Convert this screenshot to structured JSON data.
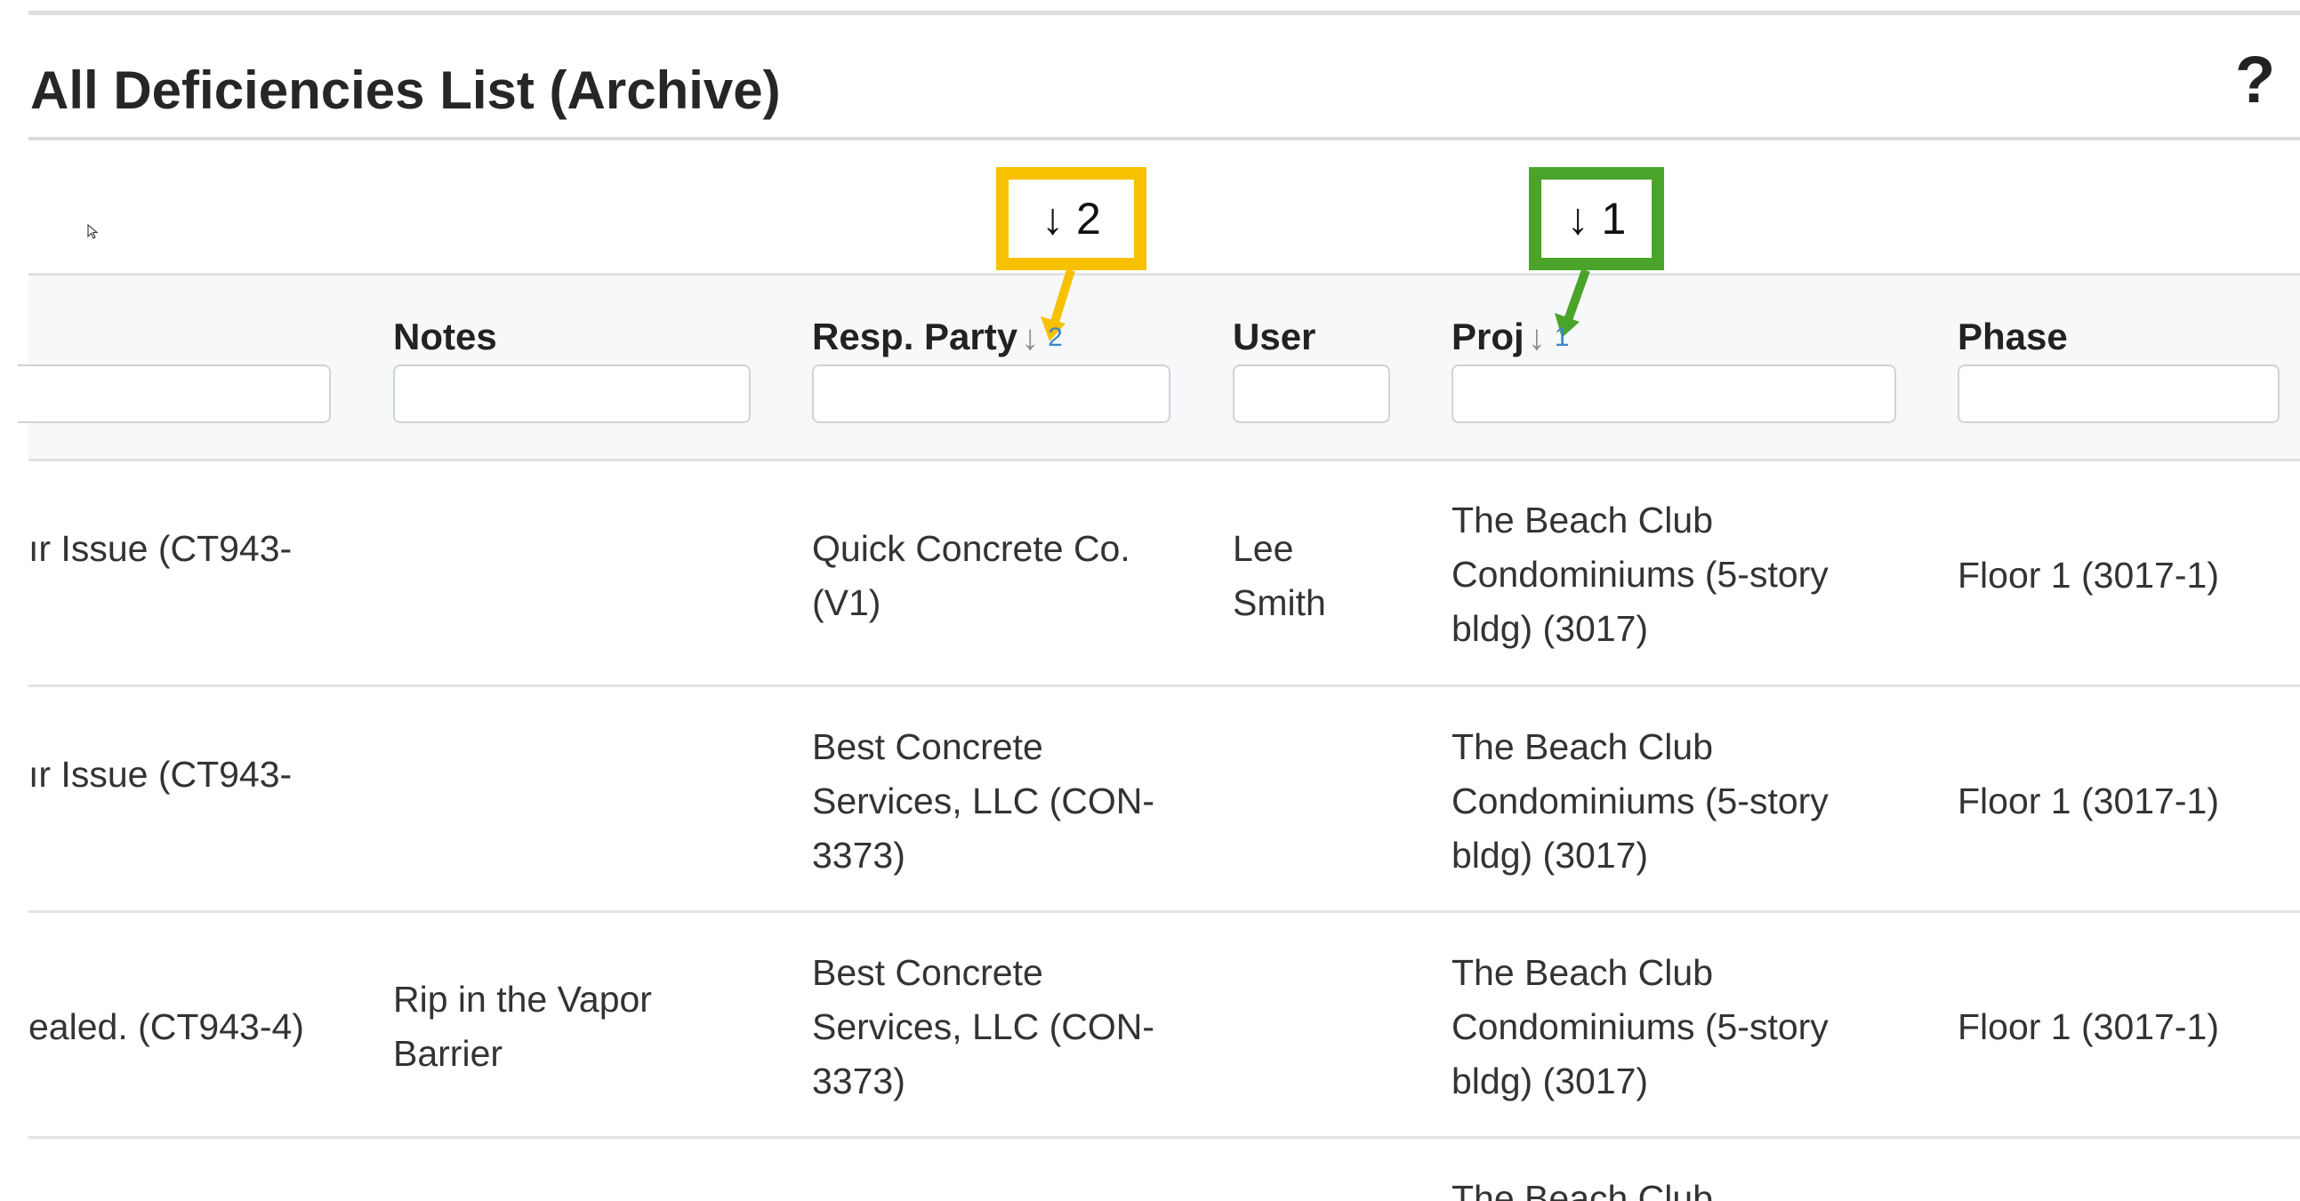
{
  "page": {
    "title": "All Deficiencies List (Archive)",
    "help_label": "?"
  },
  "callouts": {
    "secondary": {
      "arrow": "🡓",
      "label": "↓ 2"
    },
    "primary": {
      "label": "↓ 1"
    },
    "colors": {
      "secondary": "#f7c100",
      "primary": "#4aa42a"
    }
  },
  "columns": {
    "notes": {
      "label": "Notes"
    },
    "resp_party": {
      "label": "Resp. Party",
      "sort_arrow": "↓",
      "sort_order": "2"
    },
    "user": {
      "label": "User"
    },
    "proj": {
      "label": "Proj",
      "sort_arrow": "↓",
      "sort_order": "1"
    },
    "phase": {
      "label": "Phase"
    }
  },
  "filters": {
    "desc": "",
    "notes": "",
    "resp_party": "",
    "user": "",
    "proj": "",
    "phase": ""
  },
  "rows": [
    {
      "desc": "ır Issue (CT943-",
      "notes": "",
      "resp": [
        "Quick Concrete Co.",
        "(V1)"
      ],
      "user": [
        "Lee",
        "Smith"
      ],
      "proj": [
        "The Beach Club",
        "Condominiums (5-story",
        "bldg) (3017)"
      ],
      "phase": "Floor 1 (3017-1)"
    },
    {
      "desc": "ır Issue (CT943-",
      "notes": "",
      "resp": [
        "Best Concrete",
        "Services, LLC (CON-",
        "3373)"
      ],
      "user": [
        "",
        ""
      ],
      "proj": [
        "The Beach Club",
        "Condominiums (5-story",
        "bldg) (3017)"
      ],
      "phase": "Floor 1 (3017-1)"
    },
    {
      "desc": "ealed. (CT943-4)",
      "notes": [
        "Rip in the Vapor",
        "Barrier"
      ],
      "resp": [
        "Best Concrete",
        "Services, LLC (CON-",
        "3373)"
      ],
      "user": [
        "",
        ""
      ],
      "proj": [
        "The Beach Club",
        "Condominiums (5-story",
        "bldg) (3017)"
      ],
      "phase": "Floor 1 (3017-1)"
    },
    {
      "proj_partial": "The Beach Club"
    }
  ]
}
